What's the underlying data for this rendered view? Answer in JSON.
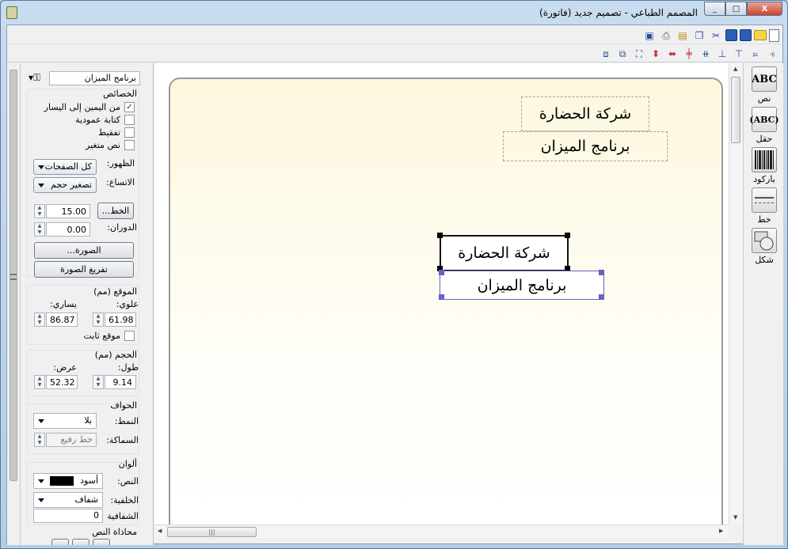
{
  "window": {
    "title": "المصمم الطباعي - تصميم جديد (فاتورة)",
    "min": "_",
    "max": "□",
    "close": "X"
  },
  "toolbar1": {
    "icons": [
      "new-doc-icon",
      "open-folder-icon",
      "save-icon",
      "save-as-icon",
      "cut-icon",
      "copy-icon",
      "paste-icon",
      "print-icon",
      "print-preview-icon"
    ]
  },
  "toolbar2": {
    "icons": [
      "align-right-icon",
      "align-left-icon",
      "align-top-icon",
      "align-bottom-icon",
      "center-horizontal-icon",
      "center-vertical-icon",
      "same-width-icon",
      "same-height-icon",
      "same-size-icon",
      "bring-front-icon",
      "send-back-icon"
    ]
  },
  "panel": {
    "object_select": "برنامج الميزان",
    "props": {
      "title": "الخصائص",
      "rtl": "من اليمين إلى اليسار",
      "rtl_checked": "✓",
      "vertical": "كتابة عمودية",
      "wrap": "تفقيط",
      "variable": "نص متغير",
      "visibility_label": "الظهور:",
      "visibility_value": "كل الصفحات",
      "stretch_label": "الاتساع:",
      "stretch_value": "تصغير حجم",
      "font_btn": "الخط...",
      "font_size": "15.00",
      "rotation_label": "الدوران:",
      "rotation": "0.00",
      "image_btn": "الصورة...",
      "clear_image_btn": "تفريغ الصورة"
    },
    "pos": {
      "title": "الموقع (مم)",
      "top_label": "علوي:",
      "left_label": "يساري:",
      "top": "61.98",
      "left": "86.87",
      "fixed": "موقع ثابت"
    },
    "size": {
      "title": "الحجم (مم)",
      "h_label": "طول:",
      "w_label": "عرض:",
      "h": "9.14",
      "w": "52.32"
    },
    "border": {
      "title": "الحواف",
      "style_label": "النمط:",
      "style_value": "بلا",
      "thick_label": "السماكة:",
      "thick_value": "خط رفيع"
    },
    "colors": {
      "title": "ألوان",
      "text_label": "النص:",
      "text_value": "أسود",
      "text_color": "#000000",
      "bg_label": "الخلفية:",
      "bg_value": "شفاف",
      "opacity_label": "الشفافية",
      "opacity": "0"
    },
    "align": {
      "title": "محاذاة النص"
    }
  },
  "canvas": {
    "item1": "شركة الحضارة",
    "item2": "برنامج الميزان",
    "item3": "شركة الحضارة",
    "item4": "برنامج الميزان",
    "grip": "|||"
  },
  "tools": [
    {
      "glyph": "ABC",
      "label": "نص"
    },
    {
      "glyph": "(ABC)",
      "label": "حقل"
    },
    {
      "glyph": "",
      "label": "باركود"
    },
    {
      "glyph": "",
      "label": "خط"
    },
    {
      "glyph": "",
      "label": "شكل"
    }
  ]
}
